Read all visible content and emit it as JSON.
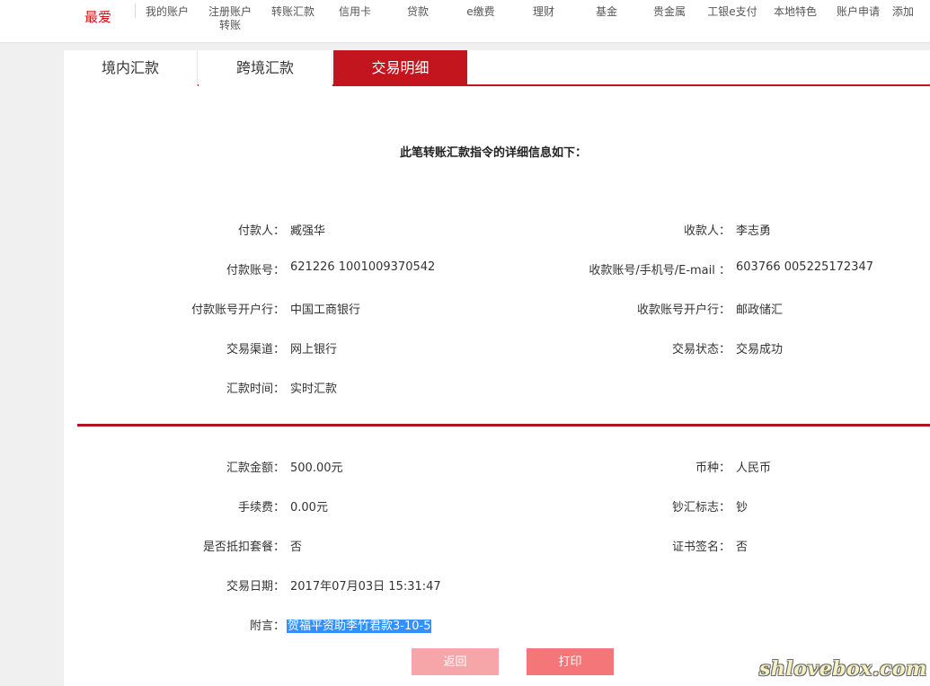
{
  "topnav": {
    "favorite": "最爱",
    "items": [
      "我的账户",
      "注册账户\n转账",
      "转账汇款",
      "信用卡",
      "贷款",
      "e缴费",
      "理财",
      "基金",
      "贵金属",
      "工银e支付",
      "本地特色",
      "账户申请",
      "添加"
    ]
  },
  "tabs": [
    "境内汇款",
    "跨境汇款",
    "交易明细"
  ],
  "heading": "此笔转账汇款指令的详细信息如下：",
  "details_top": {
    "payer_label": "付款人：",
    "payer_value": "臧强华",
    "payee_label": "收款人：",
    "payee_value": "李志勇",
    "payer_account_label": "付款账号：",
    "payer_account_value": "621226 1001009370542",
    "payee_account_label": "收款账号/手机号/E-mail ：",
    "payee_account_value": "603766 005225172347",
    "payer_bank_label": "付款账号开户行：",
    "payer_bank_value": "中国工商银行",
    "payee_bank_label": "收款账号开户行：",
    "payee_bank_value": "邮政储汇",
    "channel_label": "交易渠道：",
    "channel_value": "网上银行",
    "status_label": "交易状态：",
    "status_value": "交易成功",
    "time_label": "汇款时间：",
    "time_value": "实时汇款"
  },
  "details_bottom": {
    "amount_label": "汇款金额：",
    "amount_value": "500.00元",
    "currency_label": "币种：",
    "currency_value": "人民币",
    "fee_label": "手续费：",
    "fee_value": "0.00元",
    "cash_label": "钞汇标志：",
    "cash_value": "钞",
    "package_label": "是否抵扣套餐：",
    "package_value": "否",
    "cert_label": "证书签名：",
    "cert_value": "否",
    "date_label": "交易日期：",
    "date_value": "2017年07月03日 15:31:47",
    "note_label": "附言：",
    "note_value": "贺福平资助李竹君款3-10-5"
  },
  "buttons": {
    "back": "返回",
    "print": "打印"
  },
  "watermark": "shlovebox.com"
}
